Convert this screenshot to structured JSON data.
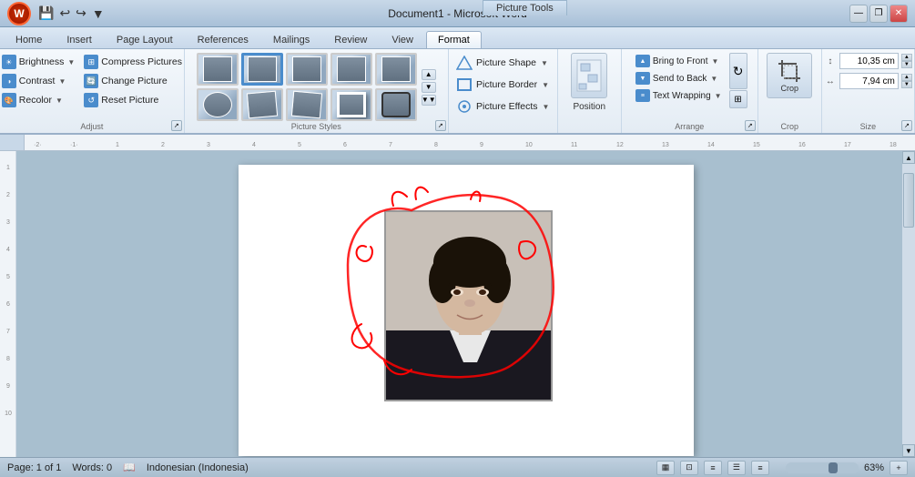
{
  "titlebar": {
    "title": "Document1 - Microsoft Word",
    "picture_tools_label": "Picture Tools",
    "controls": [
      "—",
      "❐",
      "✕"
    ]
  },
  "tabs": {
    "items": [
      "Home",
      "Insert",
      "Page Layout",
      "References",
      "Mailings",
      "Review",
      "View",
      "Format"
    ],
    "active": "Format"
  },
  "ribbon": {
    "groups": {
      "adjust": {
        "label": "Adjust",
        "buttons": [
          {
            "id": "brightness",
            "label": "Brightness"
          },
          {
            "id": "contrast",
            "label": "Contrast"
          },
          {
            "id": "recolor",
            "label": "Recolor"
          },
          {
            "id": "compress",
            "label": "Compress Pictures"
          },
          {
            "id": "change",
            "label": "Change Picture"
          },
          {
            "id": "reset",
            "label": "Reset Picture"
          }
        ]
      },
      "picture_styles": {
        "label": "Picture Styles"
      },
      "picture_options": {
        "buttons": [
          {
            "id": "shape",
            "label": "Picture Shape"
          },
          {
            "id": "border",
            "label": "Picture Border"
          },
          {
            "id": "effects",
            "label": "Picture Effects"
          }
        ]
      },
      "position": {
        "label": "Position"
      },
      "arrange": {
        "label": "Arrange",
        "buttons": [
          {
            "id": "bring_front",
            "label": "Bring to Front"
          },
          {
            "id": "send_back",
            "label": "Send to Back"
          },
          {
            "id": "text_wrapping",
            "label": "Text Wrapping"
          }
        ]
      },
      "crop": {
        "label": "Crop"
      },
      "size": {
        "label": "Size",
        "height_label": "10,35 cm",
        "width_label": "7,94 cm"
      }
    }
  },
  "status": {
    "page": "Page: 1 of 1",
    "words": "Words: 0",
    "language": "Indonesian (Indonesia)",
    "zoom": "63%"
  },
  "icons": {
    "brightness": "☀",
    "contrast": "◑",
    "recolor": "🎨",
    "compress": "⊞",
    "change": "🔄",
    "reset": "↺",
    "shape": "⬡",
    "border": "▣",
    "effects": "✦",
    "position": "▦",
    "bring_front": "▲",
    "send_back": "▼",
    "text_wrap": "≡",
    "rotate": "↻",
    "crop_icon": "⊢",
    "height_icon": "↕",
    "width_icon": "↔",
    "up_arrow": "▲",
    "down_arrow": "▼"
  }
}
